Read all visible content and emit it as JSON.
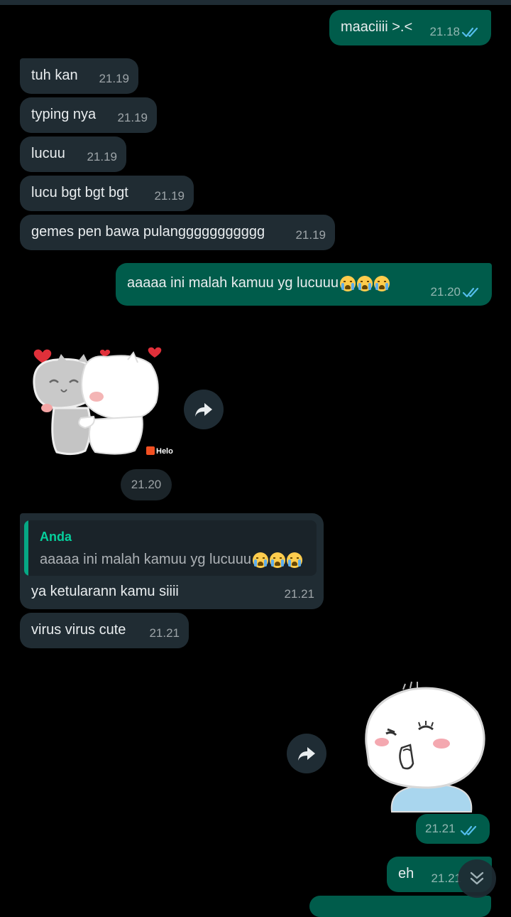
{
  "messages": [
    {
      "type": "outgoing",
      "text": "maaciiii >.<",
      "time": "21.18"
    },
    {
      "type": "incoming",
      "text": "tuh kan",
      "time": "21.19"
    },
    {
      "type": "incoming",
      "text": "typing nya",
      "time": "21.19"
    },
    {
      "type": "incoming",
      "text": "lucuu",
      "time": "21.19"
    },
    {
      "type": "incoming",
      "text": "lucu bgt bgt bgt",
      "time": "21.19"
    },
    {
      "type": "incoming",
      "text": "gemes pen bawa pulanggggggggggg",
      "time": "21.19"
    },
    {
      "type": "outgoing",
      "text": "aaaaa ini malah kamuu yg lucuuu",
      "emoji": "loudly-crying-face x3",
      "time": "21.20"
    },
    {
      "type": "incoming-sticker",
      "sticker": "hugging cats sticker",
      "watermark": "Helo",
      "time": "21.20"
    },
    {
      "type": "incoming-reply",
      "quote_sender": "Anda",
      "quote_text": "aaaaa ini malah kamuu yg lucuuu",
      "text": "ya ketularann kamu siiii",
      "time": "21.21"
    },
    {
      "type": "incoming",
      "text": "virus virus cute",
      "time": "21.21"
    },
    {
      "type": "outgoing-sticker",
      "sticker": "shy white cat sticker",
      "time": "21.21"
    },
    {
      "type": "outgoing",
      "text": "eh",
      "time": "21.21"
    }
  ],
  "icons": {
    "read_receipt": "double-check-icon",
    "forward": "forward-icon",
    "scroll_down": "double-chevron-down-icon"
  },
  "colors": {
    "background": "#000000",
    "incoming_bubble": "#202c33",
    "outgoing_bubble": "#005c4b",
    "read_tick": "#53bdeb",
    "quote_accent": "#06cf9c"
  }
}
